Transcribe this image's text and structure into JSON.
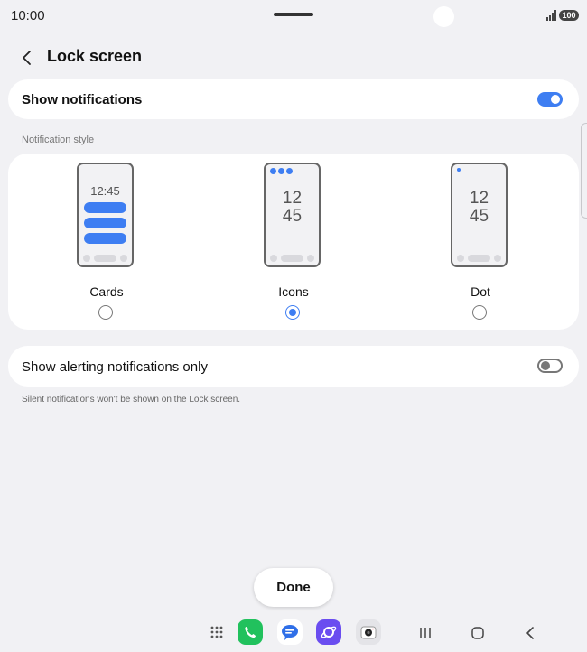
{
  "status_bar": {
    "time": "10:00",
    "battery": "100"
  },
  "header": {
    "title": "Lock screen"
  },
  "show_notifications": {
    "label": "Show notifications",
    "enabled": true
  },
  "notification_style": {
    "section_label": "Notification style",
    "options": [
      {
        "label": "Cards",
        "preview_time": "12:45",
        "selected": false
      },
      {
        "label": "Icons",
        "preview_hour": "12",
        "preview_minute": "45",
        "selected": true
      },
      {
        "label": "Dot",
        "preview_hour": "12",
        "preview_minute": "45",
        "selected": false
      }
    ]
  },
  "alerting_only": {
    "label": "Show alerting notifications only",
    "enabled": false,
    "helper": "Silent notifications won't be shown on the Lock screen."
  },
  "done_button": {
    "label": "Done"
  },
  "taskbar": {
    "apps": [
      "app-drawer-icon",
      "phone-app-icon",
      "messages-app-icon",
      "internet-app-icon",
      "camera-app-icon"
    ],
    "nav": [
      "recents-icon",
      "home-icon",
      "back-icon"
    ]
  },
  "colors": {
    "accent": "#3e7ef2",
    "background": "#f1f1f4",
    "card": "#ffffff"
  }
}
